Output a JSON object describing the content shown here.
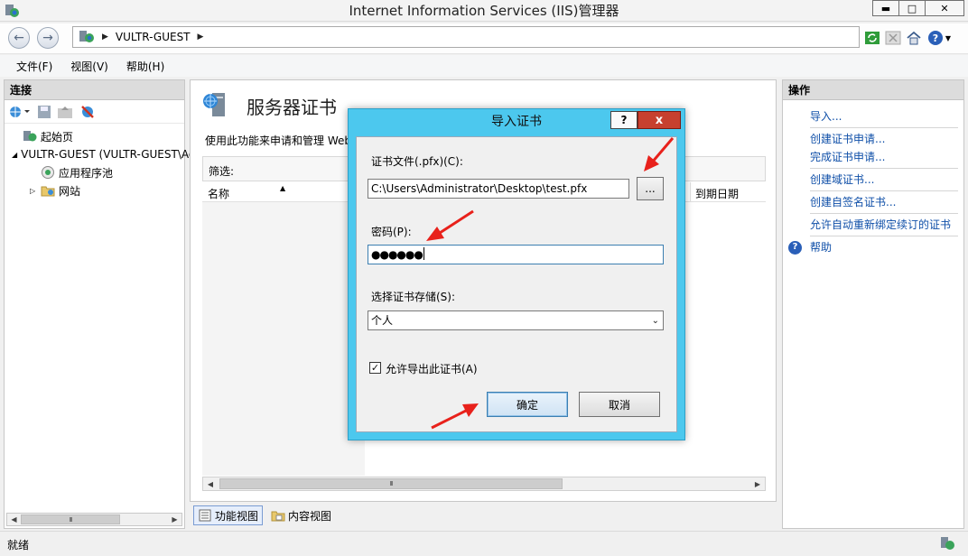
{
  "window": {
    "title": "Internet Information Services (IIS)管理器",
    "min_glyph": "▬",
    "max_glyph": "□",
    "close_glyph": "✕"
  },
  "address": {
    "separator": "▶",
    "crumbs": [
      "VULTR-GUEST"
    ]
  },
  "menu": {
    "items": [
      "文件(F)",
      "视图(V)",
      "帮助(H)"
    ]
  },
  "connections": {
    "header": "连接",
    "tree": [
      {
        "label": "起始页",
        "expander": ""
      },
      {
        "label": "VULTR-GUEST (VULTR-GUEST\\Administrator)",
        "expander": "◢"
      },
      {
        "label": "应用程序池",
        "expander": ""
      },
      {
        "label": "网站",
        "expander": "▷"
      }
    ],
    "scroll_grip": "III"
  },
  "feature": {
    "title": "服务器证书",
    "description": "使用此功能来申请和管理 Web",
    "filter_label": "筛选:",
    "filter_arrow": "▼",
    "col_name": "名称",
    "col_expiry": "到期日期",
    "sort_glyph": "▲",
    "scroll_grip": "III"
  },
  "views": {
    "features_view": "功能视图",
    "content_view": "内容视图"
  },
  "actions": {
    "header": "操作",
    "items": [
      "导入...",
      "创建证书申请...",
      "完成证书申请...",
      "创建域证书...",
      "创建自签名证书...",
      "允许自动重新绑定续订的证书"
    ],
    "help": "帮助",
    "help_glyph": "?"
  },
  "status": {
    "text": "就绪"
  },
  "dialog": {
    "title": "导入证书",
    "help_glyph": "?",
    "close_glyph": "x",
    "file_label": "证书文件(.pfx)(C):",
    "file_value": "C:\\Users\\Administrator\\Desktop\\test.pfx",
    "browse_label": "...",
    "password_label": "密码(P):",
    "password_value": "●●●●●●",
    "store_label": "选择证书存储(S):",
    "store_value": "个人",
    "store_arrow": "⌄",
    "export_label": "允许导出此证书(A)",
    "export_checked": true,
    "check_glyph": "✓",
    "ok_label": "确定",
    "cancel_label": "取消"
  },
  "colors": {
    "dialog_frame": "#4cc8ee",
    "close_red": "#c7402f",
    "link_blue": "#0f4fa8",
    "arrow_red": "#e8211b"
  }
}
